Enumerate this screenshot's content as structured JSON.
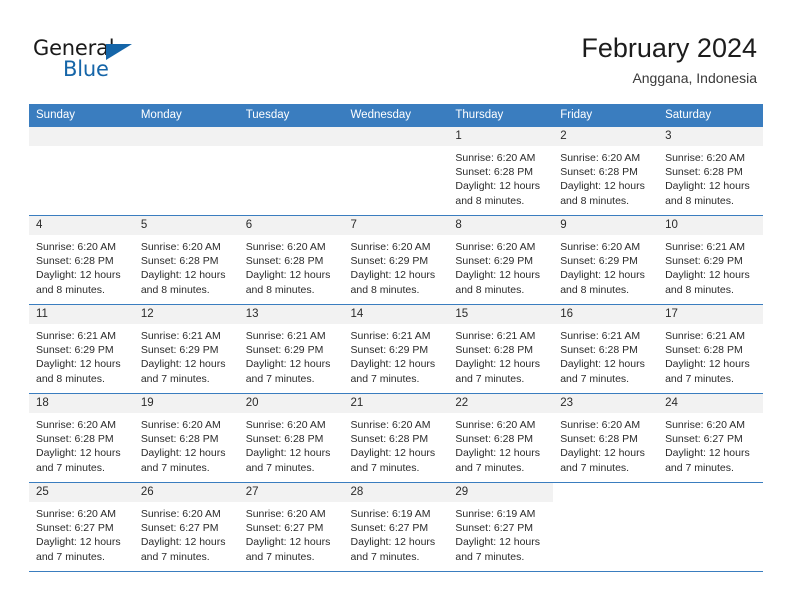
{
  "logo": {
    "word_one": "General",
    "word_two": "Blue",
    "triangle_icon": "triangle-icon",
    "accent_color": "#1565a8"
  },
  "header": {
    "title": "February 2024",
    "subtitle": "Anggana, Indonesia"
  },
  "theme": {
    "header_blue": "#3a7dbf",
    "daynum_bg": "#f2f2f2"
  },
  "calendar": {
    "weekday_headers": [
      "Sunday",
      "Monday",
      "Tuesday",
      "Wednesday",
      "Thursday",
      "Friday",
      "Saturday"
    ],
    "weeks": [
      [
        {
          "day": "",
          "blank": true
        },
        {
          "day": "",
          "blank": true
        },
        {
          "day": "",
          "blank": true
        },
        {
          "day": "",
          "blank": true
        },
        {
          "day": "1",
          "sunrise": "Sunrise: 6:20 AM",
          "sunset": "Sunset: 6:28 PM",
          "daylight": "Daylight: 12 hours and 8 minutes."
        },
        {
          "day": "2",
          "sunrise": "Sunrise: 6:20 AM",
          "sunset": "Sunset: 6:28 PM",
          "daylight": "Daylight: 12 hours and 8 minutes."
        },
        {
          "day": "3",
          "sunrise": "Sunrise: 6:20 AM",
          "sunset": "Sunset: 6:28 PM",
          "daylight": "Daylight: 12 hours and 8 minutes."
        }
      ],
      [
        {
          "day": "4",
          "sunrise": "Sunrise: 6:20 AM",
          "sunset": "Sunset: 6:28 PM",
          "daylight": "Daylight: 12 hours and 8 minutes."
        },
        {
          "day": "5",
          "sunrise": "Sunrise: 6:20 AM",
          "sunset": "Sunset: 6:28 PM",
          "daylight": "Daylight: 12 hours and 8 minutes."
        },
        {
          "day": "6",
          "sunrise": "Sunrise: 6:20 AM",
          "sunset": "Sunset: 6:28 PM",
          "daylight": "Daylight: 12 hours and 8 minutes."
        },
        {
          "day": "7",
          "sunrise": "Sunrise: 6:20 AM",
          "sunset": "Sunset: 6:29 PM",
          "daylight": "Daylight: 12 hours and 8 minutes."
        },
        {
          "day": "8",
          "sunrise": "Sunrise: 6:20 AM",
          "sunset": "Sunset: 6:29 PM",
          "daylight": "Daylight: 12 hours and 8 minutes."
        },
        {
          "day": "9",
          "sunrise": "Sunrise: 6:20 AM",
          "sunset": "Sunset: 6:29 PM",
          "daylight": "Daylight: 12 hours and 8 minutes."
        },
        {
          "day": "10",
          "sunrise": "Sunrise: 6:21 AM",
          "sunset": "Sunset: 6:29 PM",
          "daylight": "Daylight: 12 hours and 8 minutes."
        }
      ],
      [
        {
          "day": "11",
          "sunrise": "Sunrise: 6:21 AM",
          "sunset": "Sunset: 6:29 PM",
          "daylight": "Daylight: 12 hours and 8 minutes."
        },
        {
          "day": "12",
          "sunrise": "Sunrise: 6:21 AM",
          "sunset": "Sunset: 6:29 PM",
          "daylight": "Daylight: 12 hours and 7 minutes."
        },
        {
          "day": "13",
          "sunrise": "Sunrise: 6:21 AM",
          "sunset": "Sunset: 6:29 PM",
          "daylight": "Daylight: 12 hours and 7 minutes."
        },
        {
          "day": "14",
          "sunrise": "Sunrise: 6:21 AM",
          "sunset": "Sunset: 6:29 PM",
          "daylight": "Daylight: 12 hours and 7 minutes."
        },
        {
          "day": "15",
          "sunrise": "Sunrise: 6:21 AM",
          "sunset": "Sunset: 6:28 PM",
          "daylight": "Daylight: 12 hours and 7 minutes."
        },
        {
          "day": "16",
          "sunrise": "Sunrise: 6:21 AM",
          "sunset": "Sunset: 6:28 PM",
          "daylight": "Daylight: 12 hours and 7 minutes."
        },
        {
          "day": "17",
          "sunrise": "Sunrise: 6:21 AM",
          "sunset": "Sunset: 6:28 PM",
          "daylight": "Daylight: 12 hours and 7 minutes."
        }
      ],
      [
        {
          "day": "18",
          "sunrise": "Sunrise: 6:20 AM",
          "sunset": "Sunset: 6:28 PM",
          "daylight": "Daylight: 12 hours and 7 minutes."
        },
        {
          "day": "19",
          "sunrise": "Sunrise: 6:20 AM",
          "sunset": "Sunset: 6:28 PM",
          "daylight": "Daylight: 12 hours and 7 minutes."
        },
        {
          "day": "20",
          "sunrise": "Sunrise: 6:20 AM",
          "sunset": "Sunset: 6:28 PM",
          "daylight": "Daylight: 12 hours and 7 minutes."
        },
        {
          "day": "21",
          "sunrise": "Sunrise: 6:20 AM",
          "sunset": "Sunset: 6:28 PM",
          "daylight": "Daylight: 12 hours and 7 minutes."
        },
        {
          "day": "22",
          "sunrise": "Sunrise: 6:20 AM",
          "sunset": "Sunset: 6:28 PM",
          "daylight": "Daylight: 12 hours and 7 minutes."
        },
        {
          "day": "23",
          "sunrise": "Sunrise: 6:20 AM",
          "sunset": "Sunset: 6:28 PM",
          "daylight": "Daylight: 12 hours and 7 minutes."
        },
        {
          "day": "24",
          "sunrise": "Sunrise: 6:20 AM",
          "sunset": "Sunset: 6:27 PM",
          "daylight": "Daylight: 12 hours and 7 minutes."
        }
      ],
      [
        {
          "day": "25",
          "sunrise": "Sunrise: 6:20 AM",
          "sunset": "Sunset: 6:27 PM",
          "daylight": "Daylight: 12 hours and 7 minutes."
        },
        {
          "day": "26",
          "sunrise": "Sunrise: 6:20 AM",
          "sunset": "Sunset: 6:27 PM",
          "daylight": "Daylight: 12 hours and 7 minutes."
        },
        {
          "day": "27",
          "sunrise": "Sunrise: 6:20 AM",
          "sunset": "Sunset: 6:27 PM",
          "daylight": "Daylight: 12 hours and 7 minutes."
        },
        {
          "day": "28",
          "sunrise": "Sunrise: 6:19 AM",
          "sunset": "Sunset: 6:27 PM",
          "daylight": "Daylight: 12 hours and 7 minutes."
        },
        {
          "day": "29",
          "sunrise": "Sunrise: 6:19 AM",
          "sunset": "Sunset: 6:27 PM",
          "daylight": "Daylight: 12 hours and 7 minutes."
        },
        {
          "day": "",
          "blank": true
        },
        {
          "day": "",
          "blank": true
        }
      ]
    ]
  }
}
